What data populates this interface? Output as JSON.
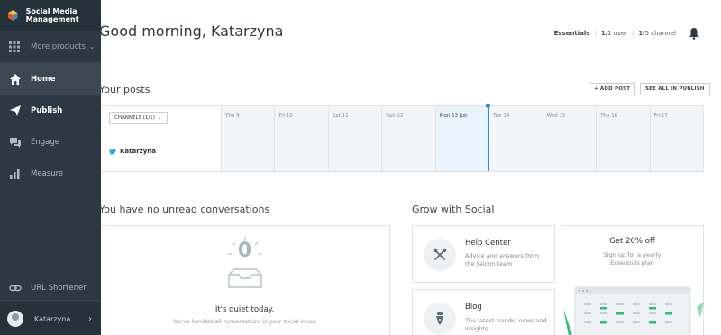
{
  "sidebar": {
    "brand": "Social Media Management",
    "more_products": "More products",
    "items": [
      {
        "label": "Home",
        "icon": "home-icon"
      },
      {
        "label": "Publish",
        "icon": "paper-plane-icon"
      },
      {
        "label": "Engage",
        "icon": "chat-icon"
      },
      {
        "label": "Measure",
        "icon": "bar-chart-icon"
      }
    ],
    "url_shortener": "URL Shortener",
    "user_name": "Katarzyna"
  },
  "header": {
    "greeting": "Good morning, Katarzyna",
    "plan": "Essentials",
    "users_used": "1",
    "users_total": "/1 user",
    "channels_used": "1",
    "channels_total": "/5 channel"
  },
  "posts": {
    "title": "Your posts",
    "add_post": "+ ADD POST",
    "see_all": "SEE ALL IN PUBLISH",
    "channels_filter": "CHANNELS (1/1)",
    "channel_name": "Katarzyna",
    "days": [
      "Thu 9",
      "Fri 10",
      "Sat 11",
      "Sun 12",
      "Mon 13 Jun",
      "Tue 14",
      "Wed 15",
      "Thu 16",
      "Fri 17"
    ]
  },
  "conversations": {
    "title": "You have no unread conversations",
    "count": "0",
    "quiet": "It's quiet today.",
    "quiet_sub": "You've handled all conversations in your social inbox."
  },
  "grow": {
    "title": "Grow with Social",
    "help_title": "Help Center",
    "help_desc": "Advice and answers from the Falcon team",
    "blog_title": "Blog",
    "blog_desc": "The latest trends, news and insights",
    "promo_title": "Get 20% off",
    "promo_desc": "Sign up for a yearly Essentials plan"
  },
  "colors": {
    "sidebar_bg": "#2d3942",
    "accent_blue": "#2b8fd6",
    "promo_green": "#2fbf71"
  }
}
